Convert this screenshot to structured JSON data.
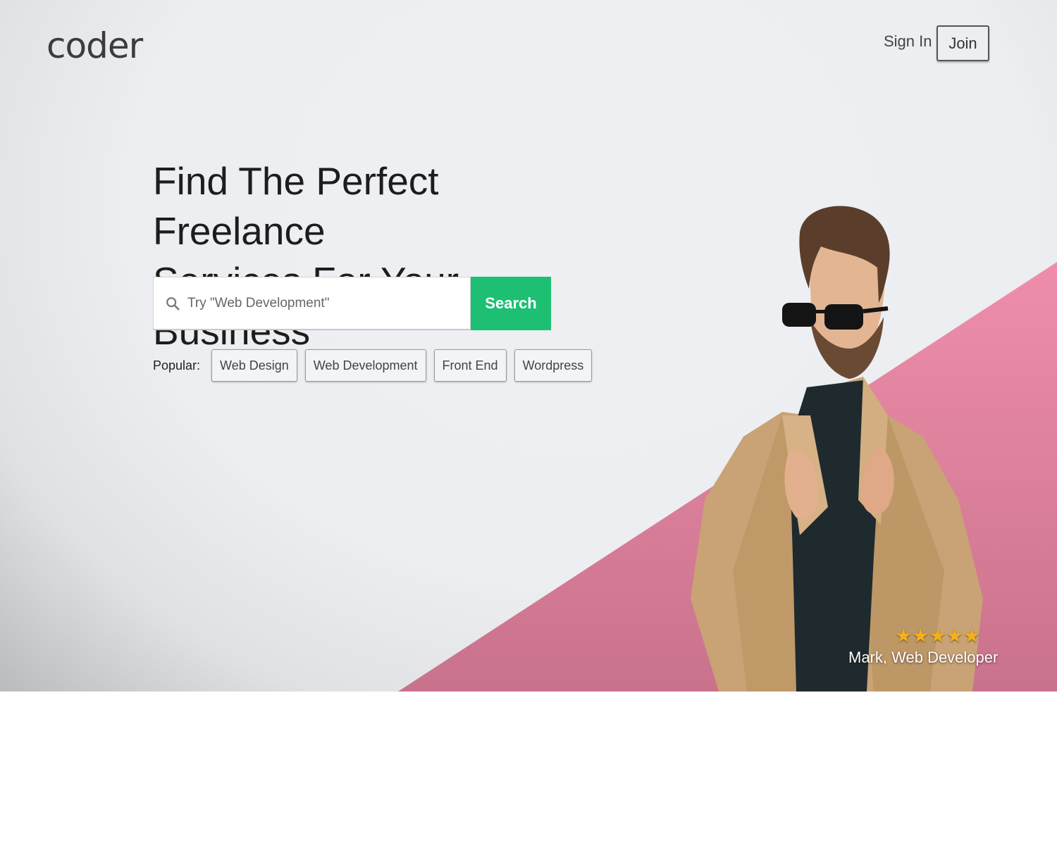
{
  "header": {
    "logo": "coder",
    "sign_in_label": "Sign In",
    "join_label": "Join"
  },
  "hero": {
    "headline_line1": "Find The Perfect Freelance",
    "headline_line2": "Services For Your Business",
    "search": {
      "placeholder": "Try \"Web Development\"",
      "button_label": "Search"
    },
    "popular": {
      "label": "Popular:",
      "tags": [
        "Web Design",
        "Web Development",
        "Front End",
        "Wordpress"
      ]
    },
    "testimonial": {
      "rating": 5,
      "caption": "Mark, Web Developer"
    }
  },
  "colors": {
    "accent_green": "#1dbf73",
    "pink_band": "#ec8aa8",
    "star": "#f2b01e"
  },
  "icons": [
    "search-icon",
    "star-icon"
  ]
}
